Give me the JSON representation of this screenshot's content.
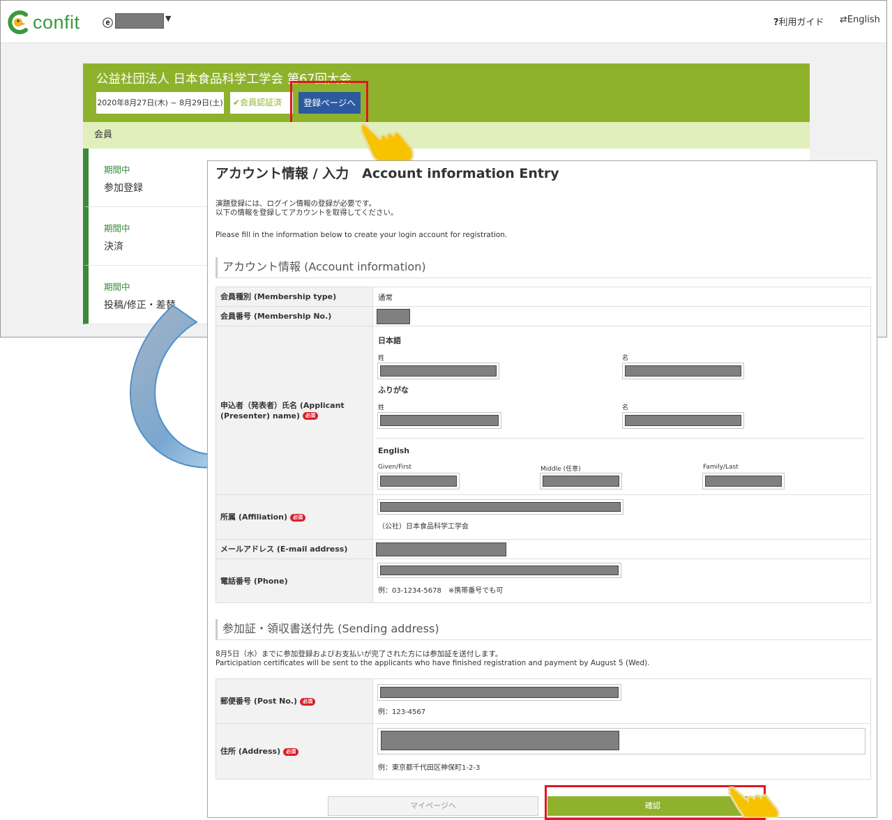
{
  "topbar": {
    "logo_text": "confit",
    "help_label": "利用ガイド",
    "lang_label": "English"
  },
  "conference": {
    "title": "公益社団法人 日本食品科学工学会 第67回大会",
    "dates": "2020年8月27日(木) ~ 8月29日(土)",
    "member_status": "会員認証済",
    "register_button": "登録ページへ"
  },
  "member_bar": "会員",
  "left_items": [
    {
      "status": "期間中",
      "name": "参加登録"
    },
    {
      "status": "期間中",
      "name": "決済"
    },
    {
      "status": "期間中",
      "name": "投稿/修正・差替"
    }
  ],
  "form": {
    "title": "アカウント情報 / 入力　Account information Entry",
    "intro_jp_1": "演題登録には、ログイン情報の登録が必要です。",
    "intro_jp_2": "以下の情報を登録してアカウントを取得してください。",
    "intro_en": "Please fill in the information below to create your login account for registration.",
    "section1": "アカウント情報 (Account information)",
    "membership_type_label": "会員種別 (Membership type)",
    "membership_type_value": "通常",
    "membership_no_label": "会員番号 (Membership No.)",
    "name_label": "申込者（発表者）氏名 (Applicant (Presenter) name)",
    "required": "必須",
    "japanese_label": "日本語",
    "furigana_label": "ふりがな",
    "sei": "姓",
    "mei": "名",
    "english_label": "English",
    "given_label": "Given/First",
    "middle_label": "Middle (任意)",
    "family_label": "Family/Last",
    "affiliation_label": "所属 (Affiliation)",
    "affiliation_hint": "（公社）日本食品科学工学会",
    "email_label": "メールアドレス (E-mail address)",
    "phone_label": "電話番号 (Phone)",
    "phone_hint": "例：03-1234-5678　※携帯番号でも可",
    "section2": "参加証・領収書送付先 (Sending address)",
    "section2_note_jp": "8月5日（水）までに参加登録およびお支払いが完了された方には参加証を送付します。",
    "section2_note_en": "Participation certificates will be sent to the applicants who have finished registration and payment by August 5 (Wed).",
    "post_label": "郵便番号 (Post No.)",
    "post_hint": "例：123-4567",
    "address_label": "住所 (Address)",
    "address_hint": "例：東京都千代田区神保町1-2-3",
    "mypage_button": "マイページへ",
    "confirm_button": "確認"
  }
}
